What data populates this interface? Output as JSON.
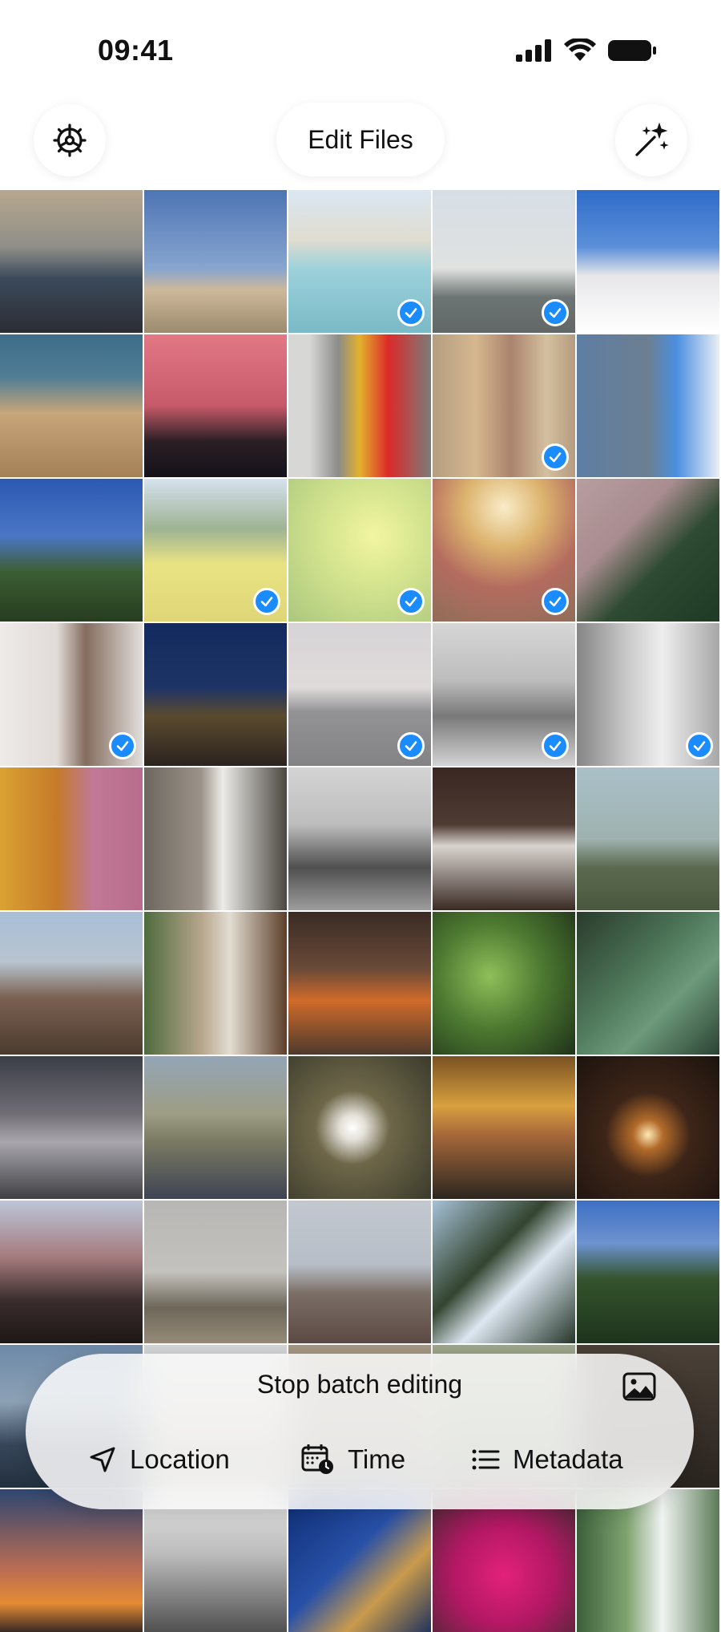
{
  "status_bar": {
    "time": "09:41",
    "icons": [
      "cellular-signal-icon",
      "wifi-icon",
      "battery-icon"
    ]
  },
  "header": {
    "title": "Edit Files",
    "left_button_icon": "gear-icon",
    "right_button_icon": "magic-wand-icon"
  },
  "colors": {
    "accent": "#1a8cff",
    "panel_bg": "#f7f7f7"
  },
  "photos": [
    {
      "subject": "sea-dusk",
      "selected": false,
      "bg": "linear-gradient(#b7a78f 0%, #8f8e88 40%, #3b4a5b 62%, #2b2d33 100%)"
    },
    {
      "subject": "lighthouse-building",
      "selected": false,
      "bg": "linear-gradient(#4d74b4 0%, #87a5cf 55%, #cdb89a 70%, #9d8b6f 100%)"
    },
    {
      "subject": "cliffs-turquoise-bay",
      "selected": true,
      "bg": "linear-gradient(#cfe0ef 0%, #d5d0c0 35%, #7cc3cf 55%, #4ea2b4 100%)"
    },
    {
      "subject": "lighthouse-hazy",
      "selected": true,
      "bg": "linear-gradient(#c9d3dd 0%, #d5d8d6 55%, #3c4745 75%, #2c3533 100%)"
    },
    {
      "subject": "lighthouse-tower",
      "selected": false,
      "bg": "linear-gradient(#2f6cc9 0%, #5b8fd8 40%, #e7e7ea 60%, #ffffff 100%)"
    },
    {
      "subject": "rocky-shore",
      "selected": false,
      "bg": "linear-gradient(#3e6d89 0%, #507d94 30%, #c7a67a 55%, #a58056 100%)"
    },
    {
      "subject": "pink-sunset-silhouette",
      "selected": false,
      "bg": "linear-gradient(#e37885 0%, #c65a69 50%, #2a1f24 75%, #15121a 100%)"
    },
    {
      "subject": "sports-cars",
      "selected": false,
      "bg": "linear-gradient(90deg, #d7d8d6 0%, #d7d8d6 15%, #8b8c88 35%, #e4b12d 50%, #dc2a2a 70%, #7b7c78 100%)"
    },
    {
      "subject": "library-books",
      "selected": true,
      "bg": "linear-gradient(90deg, #9b7d57 0%, #c8a06a 30%, #8e5a3c 55%, #c6ab80 80%, #9d7a56 100%)"
    },
    {
      "subject": "torre-glories",
      "selected": false,
      "bg": "linear-gradient(90deg, #5e7ea4 0%, #6c7f91 50%, #4b8fe0 70%, #e9eef5 100%)"
    },
    {
      "subject": "pine-tree-sky",
      "selected": false,
      "bg": "linear-gradient(#2c59b3 0%, #4b76c5 40%, #3c5e34 65%, #263d20 100%)"
    },
    {
      "subject": "yellow-field-hills",
      "selected": true,
      "bg": "linear-gradient(#c8d9e9 0%, #7e9a6f 35%, #e2da5a 60%, #d5c84a 100%)"
    },
    {
      "subject": "yellow-flowers",
      "selected": true,
      "bg": "radial-gradient(circle at 60% 40%, #eef283 0%, #c8dc6a 40%, #8fb553 100%)"
    },
    {
      "subject": "ornate-ceiling",
      "selected": true,
      "bg": "radial-gradient(circle at 50% 20%, #f7e6b5 0%, #d19a3e 30%, #9b3b2a 60%, #6b3d22 100%)"
    },
    {
      "subject": "forest-mountain",
      "selected": false,
      "bg": "linear-gradient(135deg, #b89ea0 0%, #a88c8f 35%, #2e4a31 60%, #1f3a25 100%)"
    },
    {
      "subject": "dachshund",
      "selected": true,
      "bg": "linear-gradient(90deg, #e8e4e2 0%, #d6cfca 40%, #5b3b28 60%, #d9d4d1 100%)"
    },
    {
      "subject": "city-night",
      "selected": false,
      "bg": "linear-gradient(#122a5e 0%, #1e3466 45%, #5a4a2e 65%, #2b2320 100%)"
    },
    {
      "subject": "hill-dusk",
      "selected": true,
      "bg": "linear-gradient(#c9c5c9 0%, #d6cfcf 45%, #6f6f73 62%, #5a5a5e 100%)"
    },
    {
      "subject": "cyclists",
      "selected": true,
      "bg": "linear-gradient(#c9c9c9 0%, #a7a7a7 40%, #4c4c4c 65%, #c5c5c5 100%)"
    },
    {
      "subject": "white-dog",
      "selected": true,
      "bg": "linear-gradient(90deg, #5c5c5c 0%, #b7b7b7 35%, #e9e9e9 60%, #8a8a8a 100%)"
    },
    {
      "subject": "blossom-park",
      "selected": false,
      "bg": "linear-gradient(90deg, #d9a232 0%, #c67a2a 40%, #c07996 65%, #b96c8d 100%)"
    },
    {
      "subject": "panda-statue",
      "selected": false,
      "bg": "linear-gradient(90deg, #6e6760 0%, #9c948a 40%, #ecebe7 55%, #4b4640 100%)"
    },
    {
      "subject": "street-bw",
      "selected": false,
      "bg": "linear-gradient(#d4d4d4 0%, #bdbdbd 40%, #4f4f4f 70%, #9d9d9d 100%)"
    },
    {
      "subject": "snowy-railing",
      "selected": false,
      "bg": "linear-gradient(#3b2722 0%, #4e3b33 40%, #d9d4cf 55%, #3a2a24 100%)"
    },
    {
      "subject": "raindrops-window",
      "selected": false,
      "bg": "linear-gradient(#a9c0c8 0%, #9fb2b0 50%, #5b6a4f 70%, #4a573f 100%)"
    },
    {
      "subject": "almond-blossom",
      "selected": false,
      "bg": "linear-gradient(#a9bfd7 0%, #b8c4cf 35%, #7b6152 60%, #4b3b2f 100%)"
    },
    {
      "subject": "window-seat",
      "selected": false,
      "bg": "linear-gradient(90deg, #4e6b3d 0%, #b7a58c 40%, #e2ddd2 60%, #5d3f2a 100%)"
    },
    {
      "subject": "fireplace",
      "selected": false,
      "bg": "linear-gradient(#3a2b24 0%, #6a4a38 40%, #d06b2a 62%, #4d3a2d 100%)"
    },
    {
      "subject": "green-sprout",
      "selected": false,
      "bg": "radial-gradient(circle at 40% 45%, #8fbf5a 0%, #4d7a31 45%, #1f3219 100%)"
    },
    {
      "subject": "agave-leaves",
      "selected": false,
      "bg": "linear-gradient(135deg, #2a3b2c 0%, #4b7356 40%, #6d9a7a 65%, #2b4233 100%)"
    },
    {
      "subject": "highway-traffic",
      "selected": false,
      "bg": "linear-gradient(#3b3e47 0%, #6f6c74 40%, #a9a7ad 60%, #3f3f44 100%)"
    },
    {
      "subject": "cyclist-motion",
      "selected": false,
      "bg": "linear-gradient(#93a5b6 0%, #9e9d85 40%, #7a7a63 60%, #3e4352 100%)"
    },
    {
      "subject": "white-flower",
      "selected": false,
      "bg": "radial-gradient(circle at 45% 50%, #ffffff 0%, #e3e0d8 12%, #6e6749 35%, #3b3b2c 100%)"
    },
    {
      "subject": "motorbike-night",
      "selected": false,
      "bg": "linear-gradient(#7a5222 0%, #d8a03f 35%, #a7683a 55%, #2b261f 100%)"
    },
    {
      "subject": "forest-sun",
      "selected": false,
      "bg": "radial-gradient(circle at 50% 55%, #ffe9b5 0%, #b26b2a 14%, #3d2518 40%, #1c130e 100%)"
    },
    {
      "subject": "tall-pines",
      "selected": false,
      "bg": "linear-gradient(#bcc6d9 0%, #a47a7d 40%, #3a2d2d 70%, #1d1715 100%)"
    },
    {
      "subject": "cable-car-tower",
      "selected": false,
      "bg": "linear-gradient(#b7b6b4 0%, #c4c2bd 50%, #6d6659 75%, #958b78 100%)"
    },
    {
      "subject": "port-cranes",
      "selected": false,
      "bg": "linear-gradient(#c3c8cf 0%, #b7bec7 45%, #7b6e66 65%, #5c4a44 100%)"
    },
    {
      "subject": "snowy-forest",
      "selected": false,
      "bg": "linear-gradient(135deg, #a6c0d7 0%, #33452f 40%, #dde7f1 60%, #25362a 100%)"
    },
    {
      "subject": "mountain-forest",
      "selected": false,
      "bg": "linear-gradient(#3d6fc4 0%, #6e93cf 30%, #34532c 55%, #1e331d 100%)"
    },
    {
      "subject": "coast-misty",
      "selected": false,
      "bg": "linear-gradient(#6d89a8 0%, #8da1b5 40%, #37465a 70%, #22303f 100%)"
    },
    {
      "subject": "beach-sand",
      "selected": false,
      "bg": "linear-gradient(#d4d7d9 0%, #c0bcb4 50%, #8f8a80 100%)"
    },
    {
      "subject": "warm-blur",
      "selected": false,
      "bg": "linear-gradient(#a59884 0%, #8e8675 50%, #6c6556 100%)"
    },
    {
      "subject": "green-bokeh",
      "selected": false,
      "bg": "linear-gradient(#9ea78c 0%, #7f8c6b 50%, #5e6a51 100%)"
    },
    {
      "subject": "dark-branches",
      "selected": false,
      "bg": "linear-gradient(#4b4138 0%, #3a322b 50%, #2a241f 100%)"
    },
    {
      "subject": "sunset-orange",
      "selected": false,
      "bg": "linear-gradient(#2e4670 0%, #b86c55 55%, #e48a34 80%, #3a2a24 100%)"
    },
    {
      "subject": "bare-trees",
      "selected": false,
      "bg": "linear-gradient(#e5e5e5 0%, #bdbdbd 45%, #505050 100%)"
    },
    {
      "subject": "building-night",
      "selected": false,
      "bg": "linear-gradient(135deg, #0f2d74 0%, #2750a7 45%, #c99b4c 70%, #22335e 100%)"
    },
    {
      "subject": "pink-flowers",
      "selected": false,
      "bg": "radial-gradient(circle at 50% 60%, #e3217b 0%, #b31864 45%, #3d2a2e 100%)"
    },
    {
      "subject": "waterfall",
      "selected": false,
      "bg": "linear-gradient(90deg, #3c5f3a 0%, #7ea370 35%, #f1f4f3 60%, #5a7a55 100%)"
    }
  ],
  "bottom_panel": {
    "stop_label": "Stop batch editing",
    "gallery_icon": "photo-icon",
    "tools": [
      {
        "label": "Location",
        "icon": "location-arrow-icon"
      },
      {
        "label": "Time",
        "icon": "calendar-clock-icon"
      },
      {
        "label": "Metadata",
        "icon": "list-icon"
      }
    ]
  }
}
